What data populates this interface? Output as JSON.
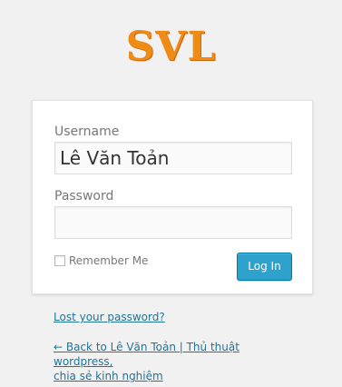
{
  "logo": {
    "text": "SVL",
    "color": "#f08b16"
  },
  "form": {
    "username_label": "Username",
    "username_value": "Lê Văn Toản",
    "password_label": "Password",
    "password_value": "",
    "remember_label": "Remember Me",
    "remember_checked": false,
    "login_button": "Log In",
    "accent_color": "#2ea2cc"
  },
  "links": {
    "lost_password": "Lost your password?",
    "back_line1": "← Back to Lê Văn Toản | Thủ thuật wordpress,",
    "back_line2": "chia sẻ kinh nghiệm"
  }
}
